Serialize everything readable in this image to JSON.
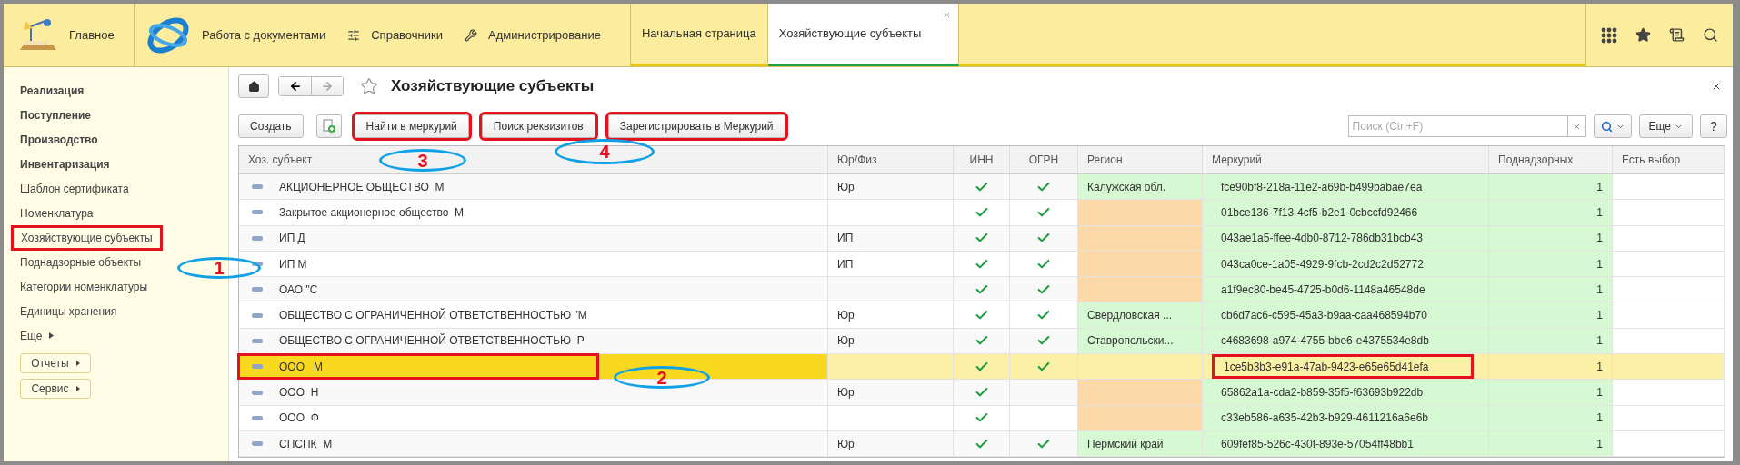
{
  "top_bar": {
    "home": {
      "label": "Главное"
    },
    "sections": [
      {
        "label": "Работа с документами",
        "kind": "logo"
      },
      {
        "label": "Справочники",
        "kind": "catalog"
      },
      {
        "label": "Администрирование",
        "kind": "admin"
      }
    ],
    "tabs": [
      {
        "label": "Начальная страница",
        "selected": false,
        "closable": false
      },
      {
        "label": "Хозяйствующие субъекты",
        "selected": true,
        "closable": true
      }
    ]
  },
  "sidebar": {
    "items": [
      {
        "label": "Реализация",
        "bold": true,
        "highlighted": false
      },
      {
        "label": "Поступление",
        "bold": true,
        "highlighted": false
      },
      {
        "label": "Производство",
        "bold": true,
        "highlighted": false
      },
      {
        "label": "Инвентаризация",
        "bold": true,
        "highlighted": false
      },
      {
        "label": "Шаблон сертификата",
        "bold": false,
        "highlighted": false
      },
      {
        "label": "Номенклатура",
        "bold": false,
        "highlighted": false
      },
      {
        "label": "Хозяйствующие субъекты",
        "bold": false,
        "highlighted": true
      },
      {
        "label": "Поднадзорные объекты",
        "bold": false,
        "highlighted": false
      },
      {
        "label": "Категории номенклатуры",
        "bold": false,
        "highlighted": false
      },
      {
        "label": "Единицы хранения",
        "bold": false,
        "highlighted": false
      }
    ],
    "more": "Еще",
    "buttons": [
      "Отчеты",
      "Сервис"
    ]
  },
  "form": {
    "title": "Хозяйствующие субъекты",
    "toolbar": [
      {
        "label": "Создать",
        "kind": "text",
        "highlighted": false
      },
      {
        "kind": "copy",
        "highlighted": false
      },
      {
        "label": "Найти в меркурий",
        "kind": "text",
        "highlighted": true
      },
      {
        "label": "Поиск реквизитов",
        "kind": "text",
        "highlighted": true
      },
      {
        "label": "Зарегистрировать в Меркурий",
        "kind": "text",
        "highlighted": true
      }
    ],
    "search": {
      "placeholder": "Поиск (Ctrl+F)"
    },
    "more_button": "Еще",
    "help_button": "?"
  },
  "table": {
    "columns": [
      "Хоз. субъект",
      "Юр/Физ",
      "ИНН",
      "ОГРН",
      "Регион",
      "Меркурий",
      "Поднадзорных",
      "Есть выбор"
    ],
    "rows": [
      {
        "name": "АКЦИОНЕРНОЕ ОБЩЕСТВО  М",
        "type": "Юр",
        "inn": true,
        "ogrn": true,
        "region": {
          "text": "Калужская обл.",
          "color": "#d6f8d2"
        },
        "mercury": "fce90bf8-218a-11e2-a69b-b499babae7ea",
        "count": "1",
        "selected": false
      },
      {
        "name": "Закрытое акционерное общество  М",
        "inn": true,
        "ogrn": true,
        "region": {
          "color": "#fcd9a8"
        },
        "mercury": "01bce136-7f13-4cf5-b2e1-0cbccfd92466",
        "count": "1",
        "selected": false
      },
      {
        "name": "ИП Д",
        "type": "ИП",
        "inn": true,
        "ogrn": true,
        "region": {
          "color": "#fcd9a8"
        },
        "mercury": "043ae1a5-ffee-4db0-8712-786db31bcb43",
        "count": "1",
        "selected": false
      },
      {
        "name": "ИП М",
        "type": "ИП",
        "inn": true,
        "ogrn": true,
        "region": {
          "color": "#fcd9a8"
        },
        "mercury": "043ca0ce-1a05-4929-9fcb-2cd2c2d52772",
        "count": "1",
        "selected": false
      },
      {
        "name": "ОАО \"С",
        "inn": true,
        "ogrn": true,
        "region": {
          "color": "#fcd9a8"
        },
        "mercury": "a1f9ec80-be45-4725-b0d6-1148a46548de",
        "count": "1",
        "selected": false
      },
      {
        "name": "ОБЩЕСТВО С ОГРАНИЧЕННОЙ ОТВЕТСТВЕННОСТЬЮ \"М",
        "type": "Юр",
        "inn": true,
        "ogrn": true,
        "region": {
          "text": "Свердловская ...",
          "color": "#d6f8d2"
        },
        "mercury": "cb6d7ac6-c595-45a3-b9aa-caa468594b70",
        "count": "1",
        "selected": false
      },
      {
        "name": "ОБЩЕСТВО С ОГРАНИЧЕННОЙ ОТВЕТСТВЕННОСТЬЮ  Р",
        "type": "Юр",
        "inn": true,
        "ogrn": true,
        "region": {
          "text": "Ставропольски...",
          "color": "#d6f8d2"
        },
        "mercury": "c4683698-a974-4755-bbe6-e4375534e8db",
        "count": "1",
        "selected": false
      },
      {
        "name": "ООО   М",
        "inn": true,
        "ogrn": true,
        "mercury": "1ce5b3b3-e91a-47ab-9423-e65e65d41efa",
        "count": "1",
        "selected": true,
        "name_highlighted": true,
        "mercury_highlighted": true
      },
      {
        "name": "ООО  Н",
        "type": "Юр",
        "inn": true,
        "ogrn": false,
        "region": {
          "color": "#fcd9a8"
        },
        "mercury": "65862a1a-cda2-b859-35f5-f63693b922db",
        "count": "1",
        "selected": false
      },
      {
        "name": "ООО  Ф",
        "inn": true,
        "ogrn": false,
        "region": {
          "color": "#fcd9a8"
        },
        "mercury": "c33eb586-a635-42b3-b929-4611216a6e6b",
        "count": "1",
        "selected": false
      },
      {
        "name": "СПСПК  М",
        "type": "Юр",
        "inn": true,
        "ogrn": true,
        "region": {
          "text": "Пермский край",
          "color": "#d6f8d2"
        },
        "mercury": "609fef85-526c-430f-893e-57054ff48bb1",
        "count": "1",
        "selected": false
      }
    ]
  },
  "callouts": [
    {
      "number": "1"
    },
    {
      "number": "2"
    },
    {
      "number": "3"
    },
    {
      "number": "4"
    }
  ]
}
